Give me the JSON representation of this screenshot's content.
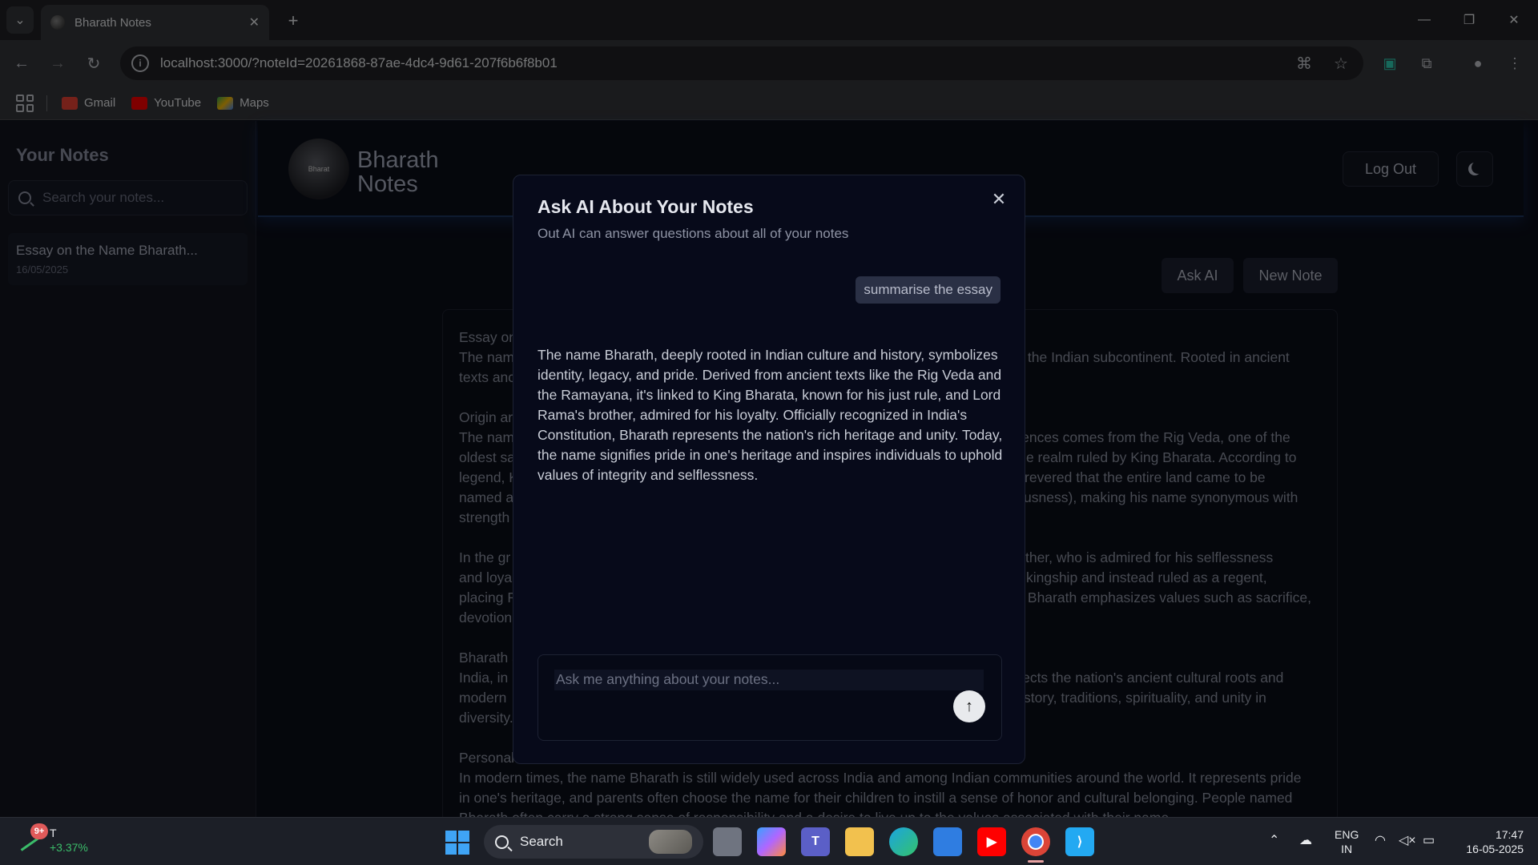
{
  "browser": {
    "tab_title": "Bharath Notes",
    "url": "localhost:3000/?noteId=20261868-87ae-4dc4-9d61-207f6b6f8b01",
    "bookmarks": [
      {
        "label": "Gmail",
        "color": "#ea4335"
      },
      {
        "label": "YouTube",
        "color": "#ff0000"
      },
      {
        "label": "Maps",
        "color": "#34a853"
      }
    ]
  },
  "sidebar": {
    "title": "Your Notes",
    "search_placeholder": "Search your notes...",
    "notes": [
      {
        "title": "Essay on the Name Bharath...",
        "date": "16/05/2025"
      }
    ]
  },
  "header": {
    "logo_text": "Bharat",
    "brand_line1": "Bharath",
    "brand_line2": "Notes",
    "logout_label": "Log Out",
    "theme_icon": "moon-icon"
  },
  "actions": {
    "ask_ai_label": "Ask AI",
    "new_note_label": "New Note"
  },
  "editor": {
    "paragraphs": [
      "Essay on\nThe nam                                                                                                                                in the Indian subcontinent. Rooted in ancient\ntexts anc                                                                                                                               .",
      "Origin ar\nThe nam                                                                                                                               erences comes from the Rig Veda, one of the\noldest sa                                                                                                                               -the realm ruled by King Bharata. According to\nlegend, K                                                                                                                               o revered that the entire land came to be\nnamed a                                                                                                                                 ousness), making his name synonymous with\nstrength",
      "In the gr                                                                                                                               brother, who is admired for his selflessness\nand loya                                                                                                                                pt kingship and instead ruled as a regent,\nplacing R                                                                                                                               of Bharath emphasizes values such as sacrifice,\ndevotion",
      "Bharath a\nIndia, in                                                                                                                               reflects the nation's ancient cultural roots and\nmodern                                                                                                                                  history, traditions, spirituality, and unity in\ndiversity.",
      "Personal\nIn modern times, the name Bharath is still widely used across India and among Indian communities around the world. It represents pride\nin one's heritage, and parents often choose the name for their children to instill a sense of honor and cultural belonging. People named\nBharath often carry a strong sense of responsibility and a desire to live up to the values associated with their name."
    ]
  },
  "dialog": {
    "title": "Ask AI About Your Notes",
    "subtitle": "Out AI can answer questions about all of your notes",
    "user_message": "summarise the essay",
    "ai_response": "The name Bharath, deeply rooted in Indian culture and history, symbolizes identity, legacy, and pride. Derived from ancient texts like the Rig Veda and the Ramayana, it's linked to King Bharata, known for his just rule, and Lord Rama's brother, admired for his loyalty. Officially recognized in India's Constitution, Bharath represents the nation's rich heritage and unity. Today, the name signifies pride in one's heritage and inspires individuals to uphold values of integrity and selflessness.",
    "input_placeholder": "Ask me anything about your notes...",
    "input_value": ""
  },
  "taskbar": {
    "stock_badge": "9+",
    "stock_symbol": "T",
    "stock_change": "+3.37%",
    "search_label": "Search",
    "lang_line1": "ENG",
    "lang_line2": "IN",
    "time": "17:47",
    "date": "16-05-2025"
  }
}
